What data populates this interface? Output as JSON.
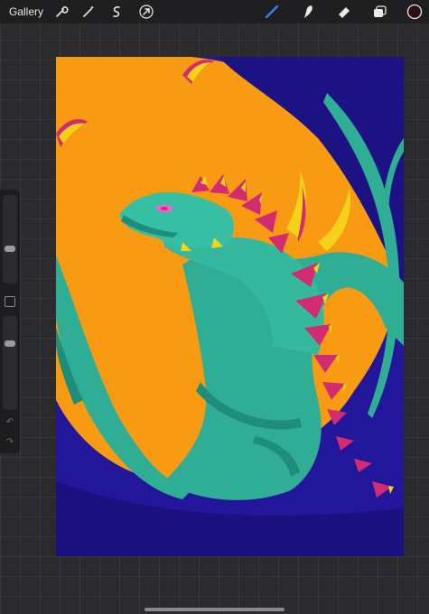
{
  "app": {
    "gallery_label": "Gallery"
  },
  "toolbar": {
    "left_tools": [
      {
        "name": "wrench-icon"
      },
      {
        "name": "magic-wand-icon"
      },
      {
        "name": "selection-s-icon"
      },
      {
        "name": "arrow-transform-icon"
      }
    ],
    "right_tools": [
      {
        "name": "brush-icon",
        "active": true
      },
      {
        "name": "smudge-icon"
      },
      {
        "name": "eraser-icon"
      },
      {
        "name": "layers-icon"
      },
      {
        "name": "color-swatch"
      }
    ],
    "active_color": "#2b0f12",
    "accent": "#3b7bf6"
  },
  "sidebar": {
    "brush_size_level": 0.38,
    "opacity_level": 0.72
  },
  "artwork": {
    "colors": {
      "background_orange": "#f89a12",
      "night_blue": "#22179a",
      "dragon_teal": "#2fae95",
      "spike_magenta": "#d22b72",
      "spike_yellow": "#f4d21a",
      "eye_pink": "#ff5ad0"
    }
  }
}
